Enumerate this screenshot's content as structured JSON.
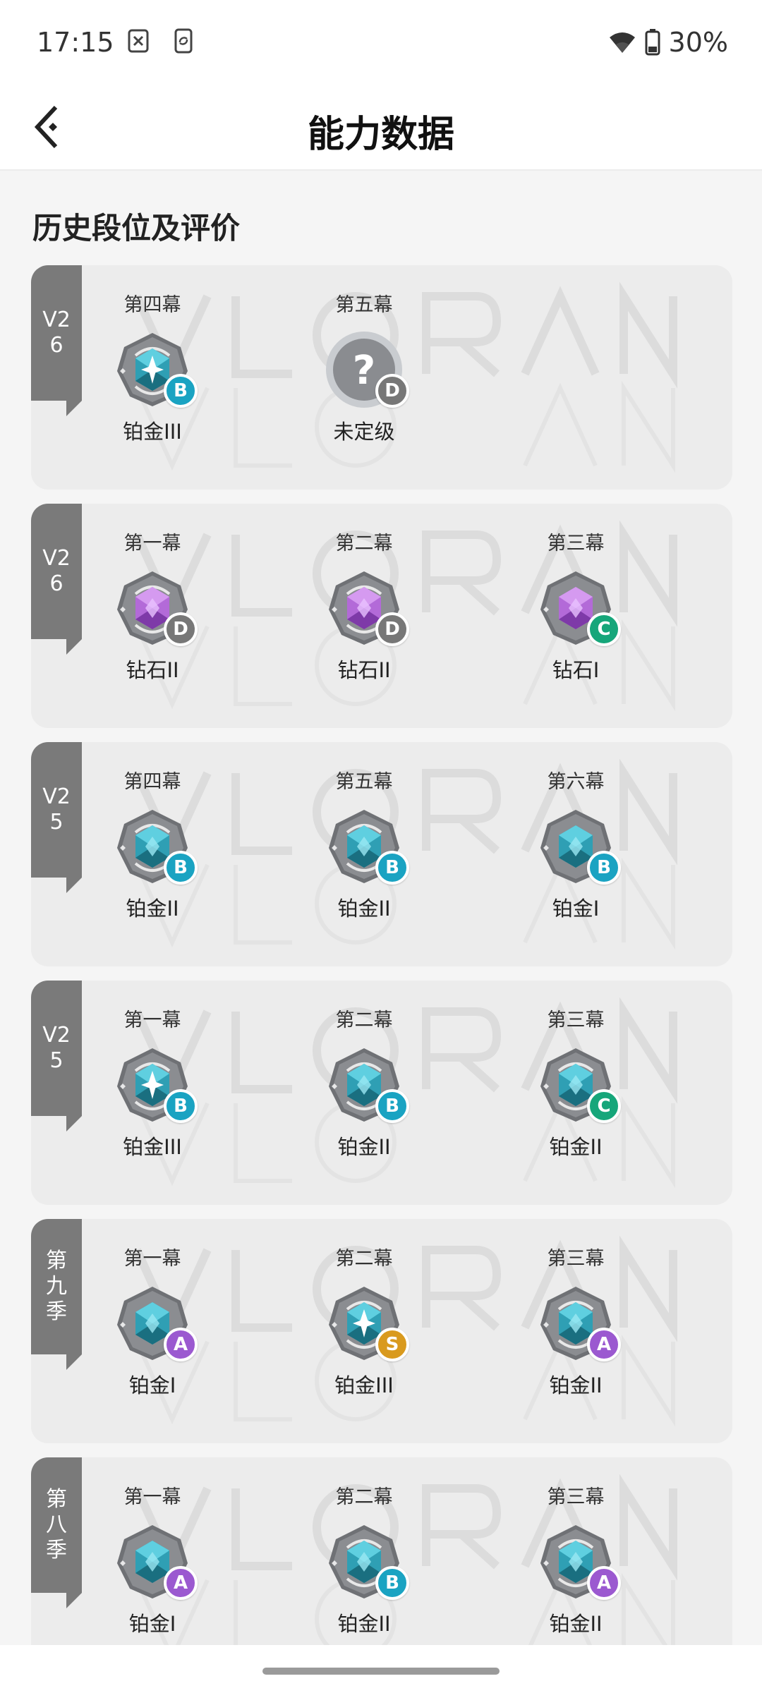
{
  "status_bar": {
    "time": "17:15",
    "battery": "30%"
  },
  "header": {
    "title": "能力数据"
  },
  "section": {
    "title": "历史段位及评价"
  },
  "grade_colors": {
    "S": "#d99a1e",
    "A": "#9b59d0",
    "B": "#1aa3c2",
    "C": "#16a67a",
    "D": "#777777"
  },
  "seasons": [
    {
      "tag": "V26",
      "acts": [
        {
          "label": "第四幕",
          "rank": "铂金III",
          "grade": "B",
          "emblem": "platinum-star"
        },
        {
          "label": "第五幕",
          "rank": "未定级",
          "grade": "D",
          "emblem": "unranked"
        }
      ]
    },
    {
      "tag": "V26",
      "acts": [
        {
          "label": "第一幕",
          "rank": "钻石II",
          "grade": "D",
          "emblem": "diamond-ring"
        },
        {
          "label": "第二幕",
          "rank": "钻石II",
          "grade": "D",
          "emblem": "diamond-ring"
        },
        {
          "label": "第三幕",
          "rank": "钻石I",
          "grade": "C",
          "emblem": "diamond"
        }
      ]
    },
    {
      "tag": "V25",
      "acts": [
        {
          "label": "第四幕",
          "rank": "铂金II",
          "grade": "B",
          "emblem": "platinum-ring"
        },
        {
          "label": "第五幕",
          "rank": "铂金II",
          "grade": "B",
          "emblem": "platinum-ring"
        },
        {
          "label": "第六幕",
          "rank": "铂金I",
          "grade": "B",
          "emblem": "platinum"
        }
      ]
    },
    {
      "tag": "V25",
      "acts": [
        {
          "label": "第一幕",
          "rank": "铂金III",
          "grade": "B",
          "emblem": "platinum-star"
        },
        {
          "label": "第二幕",
          "rank": "铂金II",
          "grade": "B",
          "emblem": "platinum-ring"
        },
        {
          "label": "第三幕",
          "rank": "铂金II",
          "grade": "C",
          "emblem": "platinum-ring"
        }
      ]
    },
    {
      "tag": "第九季",
      "acts": [
        {
          "label": "第一幕",
          "rank": "铂金I",
          "grade": "A",
          "emblem": "platinum"
        },
        {
          "label": "第二幕",
          "rank": "铂金III",
          "grade": "S",
          "emblem": "platinum-star"
        },
        {
          "label": "第三幕",
          "rank": "铂金II",
          "grade": "A",
          "emblem": "platinum-ring"
        }
      ]
    },
    {
      "tag": "第八季",
      "acts": [
        {
          "label": "第一幕",
          "rank": "铂金I",
          "grade": "A",
          "emblem": "platinum"
        },
        {
          "label": "第二幕",
          "rank": "铂金II",
          "grade": "B",
          "emblem": "platinum-ring"
        },
        {
          "label": "第三幕",
          "rank": "铂金II",
          "grade": "A",
          "emblem": "platinum-ring"
        }
      ]
    }
  ]
}
